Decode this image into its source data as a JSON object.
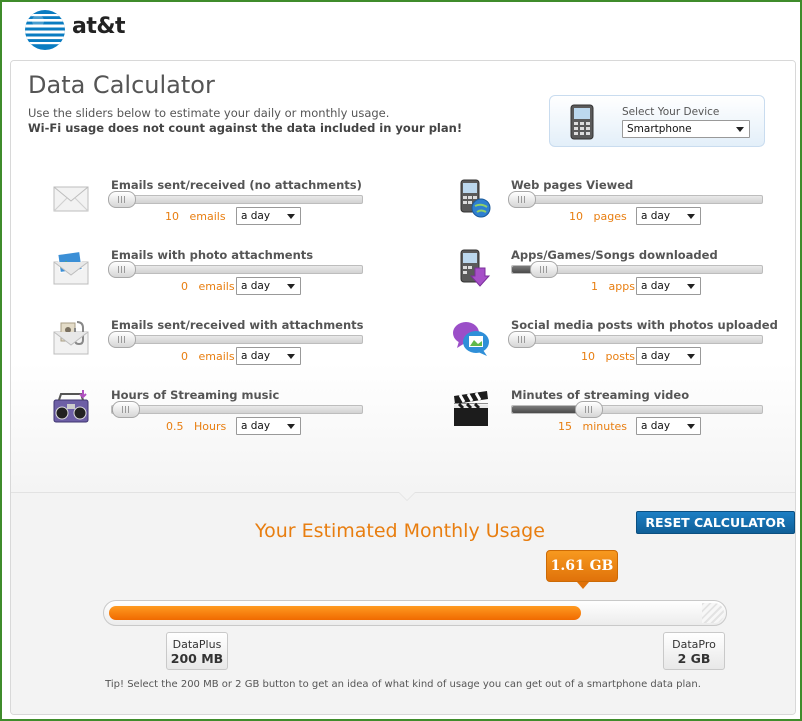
{
  "brand": {
    "name": "at&t"
  },
  "calculator": {
    "title": "Data Calculator",
    "subtitle": "Use the sliders below to estimate your daily or monthly usage.",
    "wifi_note": "Wi-Fi usage does not count against the data included in your plan!"
  },
  "device": {
    "label": "Select Your Device",
    "selected": "Smartphone"
  },
  "sliders": [
    {
      "label": "Emails sent/received (no attachments)",
      "value": "10",
      "unit": "emails",
      "period": "a day",
      "level": 0.0,
      "icon": "envelope-icon"
    },
    {
      "label": "Emails with photo attachments",
      "value": "0",
      "unit": "emails",
      "period": "a day",
      "level": 0.0,
      "icon": "photo-email-icon"
    },
    {
      "label": "Emails sent/received with attachments",
      "value": "0",
      "unit": "emails",
      "period": "a day",
      "level": 0.0,
      "icon": "attachment-email-icon"
    },
    {
      "label": "Hours of Streaming music",
      "value": "0.5",
      "unit": "Hours",
      "period": "a day",
      "level": 0.02,
      "icon": "boombox-icon"
    },
    {
      "label": "Web pages Viewed",
      "value": "10",
      "unit": "pages",
      "period": "a day",
      "level": 0.0,
      "icon": "phone-globe-icon"
    },
    {
      "label": "Apps/Games/Songs downloaded",
      "value": "1",
      "unit": "apps",
      "period": "a day",
      "level": 0.1,
      "icon": "phone-download-icon"
    },
    {
      "label": "Social media posts with photos uploaded",
      "value": "10",
      "unit": "posts",
      "period": "a day",
      "level": 0.0,
      "icon": "social-chat-icon"
    },
    {
      "label": "Minutes of streaming video",
      "value": "15",
      "unit": "minutes",
      "period": "a day",
      "level": 0.3,
      "icon": "clapperboard-icon"
    }
  ],
  "usage": {
    "title": "Your Estimated Monthly Usage",
    "reset_label": "RESET CALCULATOR",
    "estimate": "1.61 GB",
    "fill_fraction": 0.8,
    "plans": [
      {
        "name": "DataPlus",
        "size": "200 MB"
      },
      {
        "name": "DataPro",
        "size": "2 GB"
      }
    ],
    "tip": "Tip! Select the 200 MB or 2 GB button to get an idea of what kind of usage you can get out of a smartphone data plan."
  },
  "colors": {
    "accent": "#e87e10",
    "brand_blue": "#0f5f98",
    "frame_green": "#3f8c2b"
  }
}
